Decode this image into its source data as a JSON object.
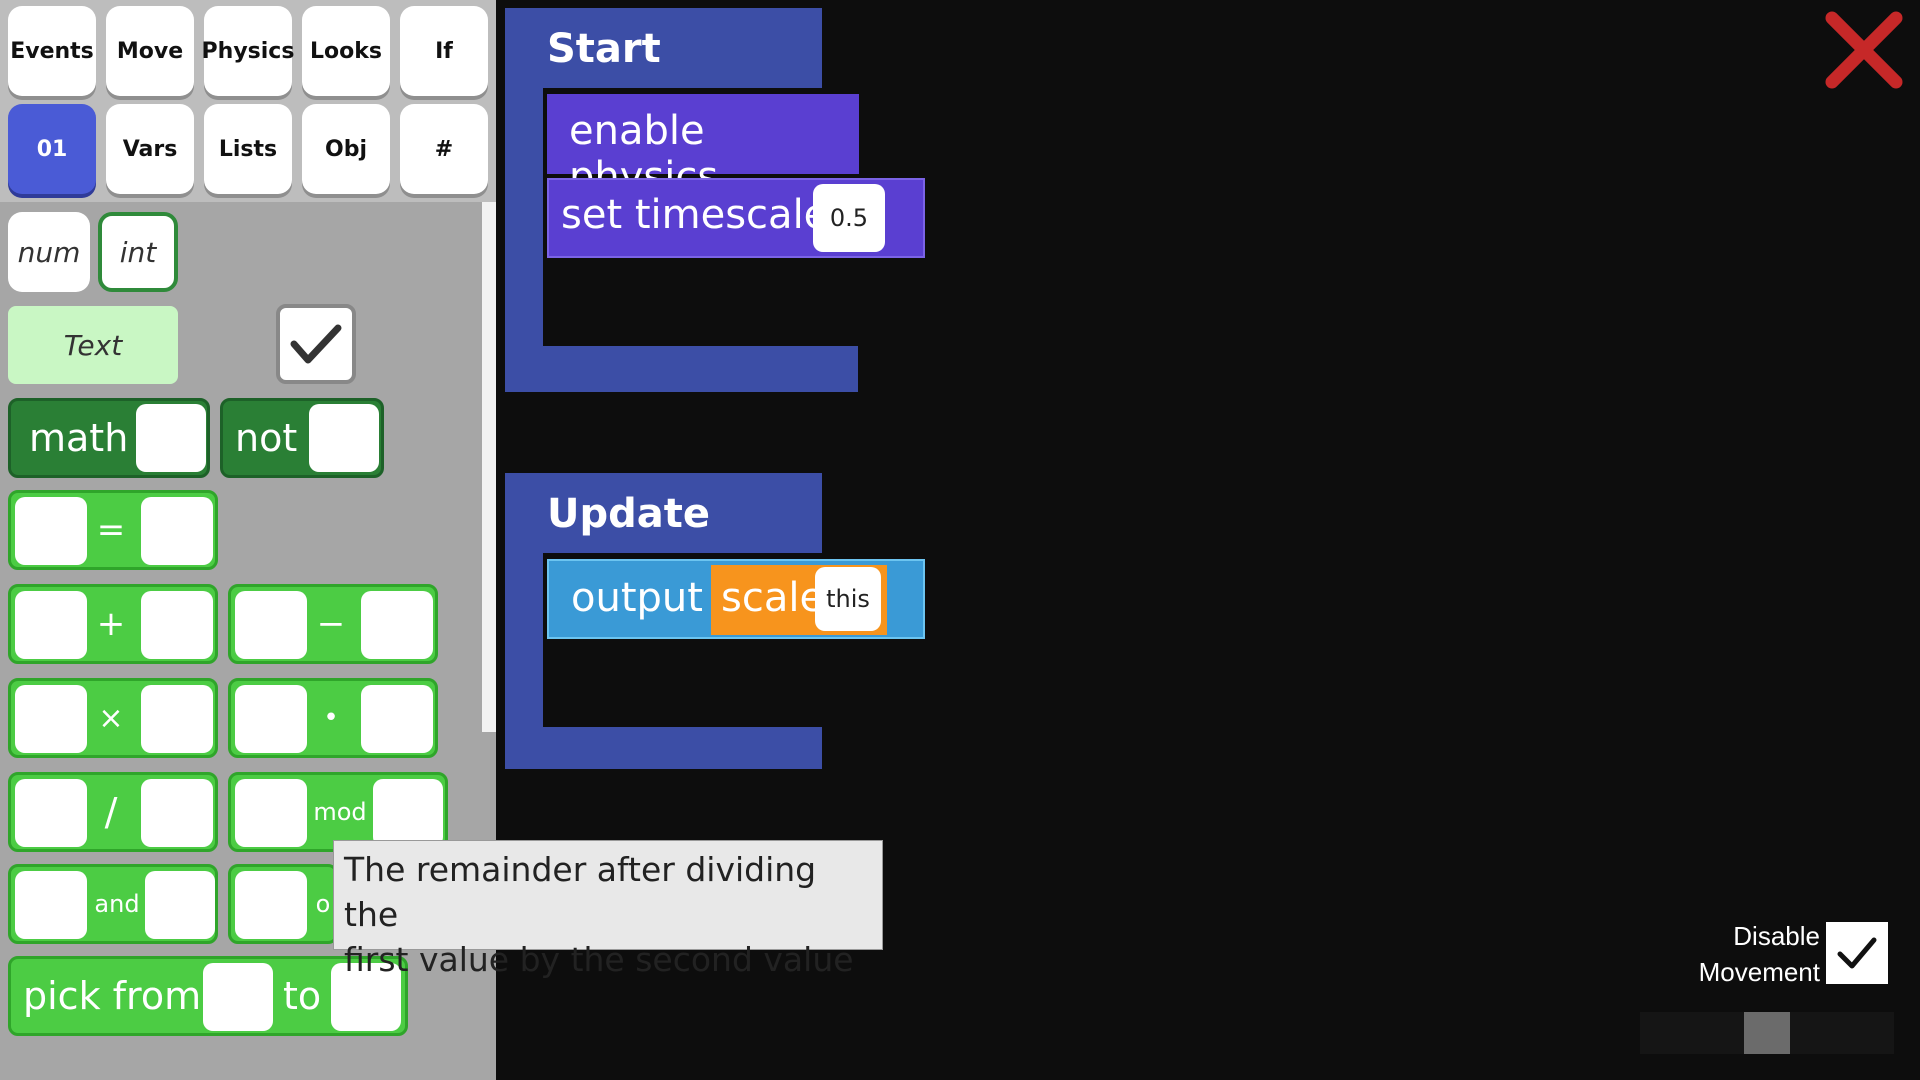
{
  "categories": [
    {
      "label": "Events",
      "active": false
    },
    {
      "label": "Move",
      "active": false
    },
    {
      "label": "Physics",
      "active": false
    },
    {
      "label": "Looks",
      "active": false
    },
    {
      "label": "If",
      "active": false
    },
    {
      "label": "01",
      "active": true
    },
    {
      "label": "Vars",
      "active": false
    },
    {
      "label": "Lists",
      "active": false
    },
    {
      "label": "Obj",
      "active": false
    },
    {
      "label": "#",
      "active": false
    }
  ],
  "palette": {
    "num_label": "num",
    "int_label": "int",
    "text_label": "Text",
    "bool_checked": true,
    "math_label": "math",
    "not_label": "not",
    "ops": {
      "eq": "=",
      "plus": "+",
      "minus": "−",
      "times": "×",
      "dot": "•",
      "divide": "/",
      "mod": "mod",
      "and": "and",
      "or": "o"
    },
    "pick_from_label": "pick from",
    "to_label": "to"
  },
  "scripts": {
    "start": {
      "title": "Start",
      "stmt1": "enable physics",
      "stmt2": "set timescale",
      "stmt2_value": "0.5"
    },
    "update": {
      "title": "Update",
      "output_label": "output",
      "scale_label": "scale",
      "scale_arg": "this"
    }
  },
  "tooltip": {
    "line1": "The remainder after dividing the",
    "line2": "first value by the second value"
  },
  "settings": {
    "disable_movement_line1": "Disable",
    "disable_movement_line2": "Movement",
    "disable_movement_checked": true
  },
  "colors": {
    "close": "#c62828",
    "event_frame": "#3c4ea6",
    "statement_purple": "#5a3fd1",
    "output_blue": "#3a9ad6",
    "scale_orange": "#f7941d",
    "green_block": "#4ccc44",
    "dark_green_block": "#2a7f35"
  }
}
